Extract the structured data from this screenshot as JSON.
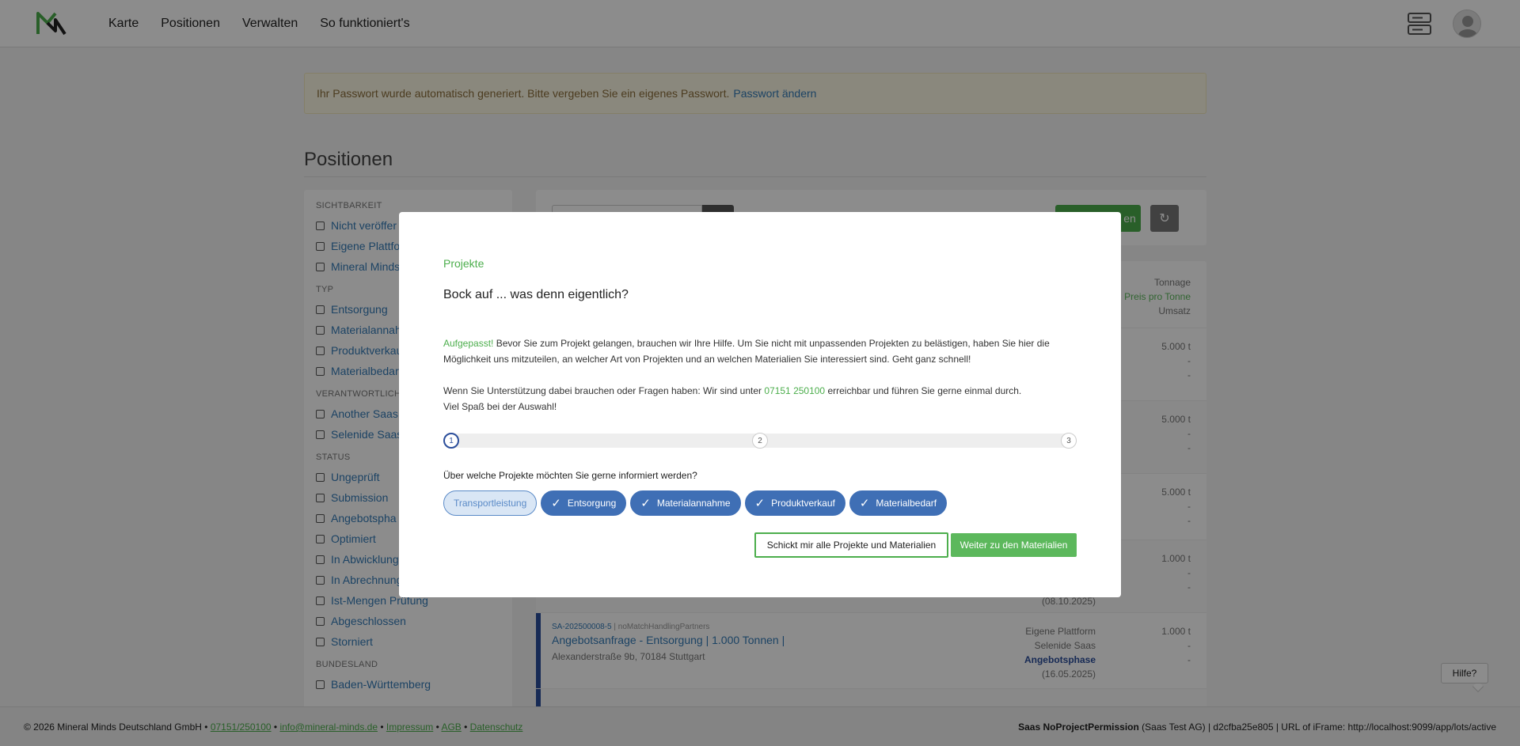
{
  "nav": {
    "links": [
      "Karte",
      "Positionen",
      "Verwalten",
      "So funktioniert's"
    ]
  },
  "alert": {
    "text": "Ihr Passwort wurde automatisch generiert. Bitte vergeben Sie ein eigenes Passwort.",
    "link": "Passwort ändern"
  },
  "page": {
    "title": "Positionen"
  },
  "filters": {
    "visibility_heading": "SICHTBARKEIT",
    "visibility": [
      "Nicht veröffer",
      "Eigene Plattfo",
      "Mineral Minds"
    ],
    "type_heading": "TYP",
    "type": [
      "Entsorgung",
      "Materialannah",
      "Produktverkau",
      "Materialbedarf"
    ],
    "responsible_heading": "VERANTWORTLICHE",
    "responsible": [
      "Another Saas",
      "Selenide Saas"
    ],
    "status_heading": "STATUS",
    "status": [
      "Ungeprüft",
      "Submission",
      "Angebotspha",
      "Optimiert",
      "In Abwicklung",
      "In Abrechnung",
      "Ist-Mengen Prüfung",
      "Abgeschlossen",
      "Storniert"
    ],
    "state_heading": "BUNDESLAND",
    "state": [
      "Baden-Württemberg"
    ]
  },
  "toolbar": {
    "green_button": "en"
  },
  "list": {
    "header": {
      "tonnage": "Tonnage",
      "price": "Preis pro Tonne",
      "revenue": "Umsatz"
    },
    "rows": [
      {
        "t": "5.000 t",
        "p": "-",
        "u": "-"
      },
      {
        "t": "5.000 t",
        "p": "-",
        "u": "-"
      },
      {
        "t": "5.000 t",
        "p": "-",
        "u": "-"
      },
      {
        "t": "1.000 t",
        "p": "-",
        "u": "-",
        "date": "(08.10.2025)"
      },
      {
        "meta_id": "SA-202500008-5",
        "meta_tag": "noMatchHandlingPartners",
        "title": "Angebotsanfrage - Entsorgung | 1.000 Tonnen |",
        "address": "Alexanderstraße 9b, 70184 Stuttgart",
        "platform": "Eigene Plattform",
        "owner": "Selenide Saas",
        "phase": "Angebotsphase",
        "date": "(16.05.2025)",
        "t": "1.000 t",
        "p": "-",
        "u": "-"
      }
    ]
  },
  "modal": {
    "kicker": "Projekte",
    "title": "Bock auf ... was denn eigentlich?",
    "p1_highlight": "Aufgepasst!",
    "p1_text": " Bevor Sie zum Projekt gelangen, brauchen wir Ihre Hilfe. Um Sie nicht mit unpassenden Projekten zu belästigen, haben Sie hier die Möglichkeit uns mitzuteilen, an welcher Art von Projekten und an welchen Materialien Sie interessiert sind. Geht ganz schnell!",
    "p2_before": "Wenn Sie Unterstützung dabei brauchen oder Fragen haben: Wir sind unter ",
    "p2_phone": "07151 250100",
    "p2_after": " erreichbar und führen Sie gerne einmal durch.",
    "p3": "Viel Spaß bei der Auswahl!",
    "steps": [
      "1",
      "2",
      "3"
    ],
    "question": "Über welche Projekte möchten Sie gerne informiert werden?",
    "chips": [
      {
        "label": "Transportleistung",
        "selected": false
      },
      {
        "label": "Entsorgung",
        "selected": true
      },
      {
        "label": "Materialannahme",
        "selected": true
      },
      {
        "label": "Produktverkauf",
        "selected": true
      },
      {
        "label": "Materialbedarf",
        "selected": true
      }
    ],
    "btn_all": "Schickt mir alle Projekte und Materialien",
    "btn_next": "Weiter zu den Materialien"
  },
  "help": {
    "label": "Hilfe?"
  },
  "footer": {
    "copyright": "© 2026 Mineral Minds Deutschland GmbH •",
    "phone": "07151/250100",
    "email": "info@mineral-minds.de",
    "imprint": "Impressum",
    "terms": "AGB",
    "privacy": "Datenschutz",
    "user": "Saas NoProjectPermission",
    "right_text": "(Saas Test AG) | d2cfba25e805 | URL of iFrame: http://localhost:9099/app/lots/active"
  },
  "colors": {
    "brand_green": "#4cae4c",
    "brand_blue": "#2b4e9b",
    "link_blue": "#337ab7"
  }
}
